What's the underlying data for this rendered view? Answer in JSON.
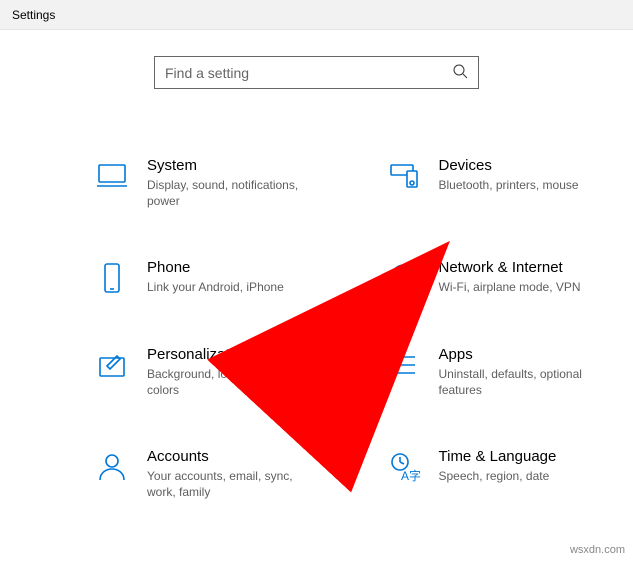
{
  "window": {
    "title": "Settings"
  },
  "search": {
    "placeholder": "Find a setting"
  },
  "tiles": [
    {
      "title": "System",
      "desc": "Display, sound, notifications, power"
    },
    {
      "title": "Devices",
      "desc": "Bluetooth, printers, mouse"
    },
    {
      "title": "Phone",
      "desc": "Link your Android, iPhone"
    },
    {
      "title": "Network & Internet",
      "desc": "Wi-Fi, airplane mode, VPN"
    },
    {
      "title": "Personalization",
      "desc": "Background, lock screen, colors"
    },
    {
      "title": "Apps",
      "desc": "Uninstall, defaults, optional features"
    },
    {
      "title": "Accounts",
      "desc": "Your accounts, email, sync, work, family"
    },
    {
      "title": "Time & Language",
      "desc": "Speech, region, date"
    }
  ],
  "annotation": {
    "color": "#FF0000"
  },
  "watermark": "wsxdn.com"
}
